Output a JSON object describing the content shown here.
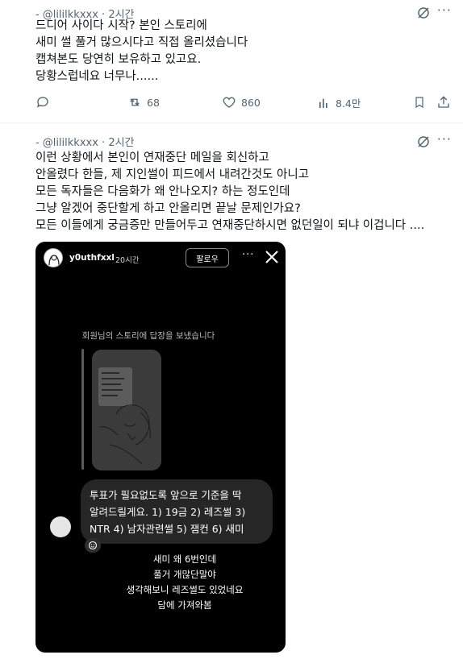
{
  "tweet1": {
    "handle": "@lililkkxxx",
    "time": "2시간",
    "lines": [
      "드디어 사이다 시작? 본인 스토리에",
      "새미 썰 풀거 많으시다고 직접 올리셨습니다",
      "캡쳐본도 당연히 보유하고 있고요.",
      "당황스럽네요 너무나......"
    ],
    "retweets": "68",
    "likes": "860",
    "views": "8.4만"
  },
  "tweet2": {
    "handle": "@lililkkxxx",
    "time": "2시간",
    "lines": [
      "이런 상황에서 본인이 연재중단 메일을 회신하고",
      "안올렸다 한들, 제 지인썰이 피드에서 내려간것도 아니고",
      "모든 독자들은 다음화가 왜 안나오지? 하는 정도인데",
      "그냥 알겠어 중단할게 하고 안올리면 끝날 문제인가요?",
      "모든 이들에게 궁금증만 만들어두고 연재중단하시면 없던일이 되냐 이겁니다 ...."
    ]
  },
  "story": {
    "username": "y0uthfxxl",
    "time": "20시간",
    "follow_label": "팔로우",
    "reply_caption": "회원님의 스토리에 답장을 보냈습니다",
    "bubble_lines": [
      "투표가 필요없도록 앞으로 기준을 딱",
      "알려드릴게요. 1) 19금 2) 레즈썰 3)",
      "NTR 4) 남자관련썰 5) 잼컨 6) 새미"
    ],
    "overlay_lines": [
      "새미 왜 6번인데",
      "풀거 개많단말야",
      "생각해보니 레즈썰도 있었네요",
      "담에 가져와봄"
    ]
  },
  "colors": {
    "text": "#0f1419",
    "muted": "#536471",
    "story_bg": "#000000",
    "bubble_bg": "#262626"
  }
}
